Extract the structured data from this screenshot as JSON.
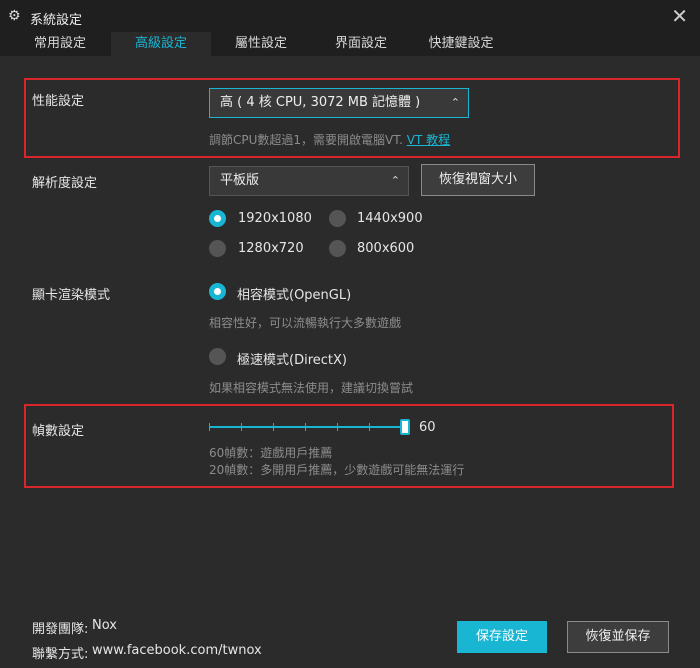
{
  "window": {
    "title": "系統設定",
    "close": "✕"
  },
  "tabs": [
    {
      "label": "常用設定"
    },
    {
      "label": "高級設定"
    },
    {
      "label": "屬性設定"
    },
    {
      "label": "界面設定"
    },
    {
      "label": "快捷鍵設定"
    }
  ],
  "performance": {
    "label": "性能設定",
    "value": "高 ( 4 核 CPU, 3072 MB 記憶體 )",
    "hint": "調節CPU數超過1，需要開啟電腦VT.",
    "hint_link": "VT 教程"
  },
  "resolution": {
    "label": "解析度設定",
    "value": "平板版",
    "restore_button": "恢復視窗大小",
    "options": [
      "1920x1080",
      "1440x900",
      "1280x720",
      "800x600"
    ],
    "selected": "1920x1080"
  },
  "render": {
    "label": "顯卡渲染模式",
    "opengl": "相容模式(OpenGL)",
    "opengl_hint": "相容性好，可以流暢執行大多數遊戲",
    "directx": "極速模式(DirectX)",
    "directx_hint": "如果相容模式無法使用，建議切換嘗試",
    "selected": "opengl"
  },
  "fps": {
    "label": "幀數設定",
    "value": "60",
    "hint1": "60幀數：遊戲用戶推薦",
    "hint2": "20幀數：多開用戶推薦，少數遊戲可能無法運行"
  },
  "footer": {
    "dev_label": "開發團隊:",
    "dev_value": "Nox",
    "contact_label": "聯繫方式:",
    "contact_value": "www.facebook.com/twnox",
    "save_button": "保存設定",
    "restore_save_button": "恢復並保存"
  },
  "colors": {
    "accent": "#19b6d4",
    "highlight_box": "#d8262a",
    "background": "#2b2b2b"
  }
}
